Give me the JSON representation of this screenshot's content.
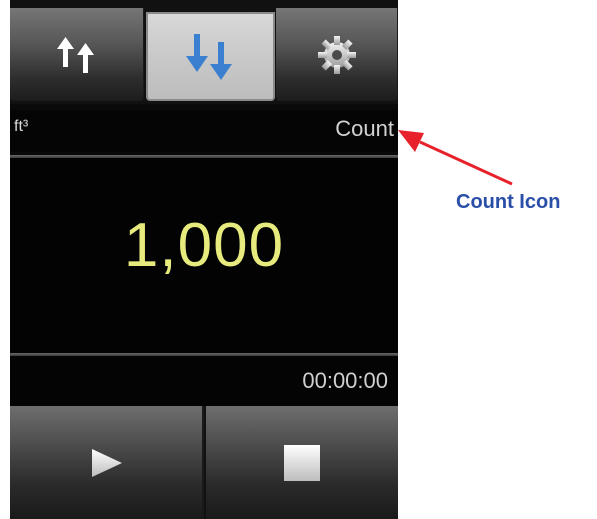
{
  "tabs": [
    {
      "name": "upload",
      "icon": "arrows-up-icon"
    },
    {
      "name": "download",
      "icon": "arrows-down-icon",
      "selected": true
    },
    {
      "name": "settings",
      "icon": "gear-icon"
    }
  ],
  "header": {
    "unit": "ft³",
    "mode": "Count"
  },
  "display": {
    "value": "1,000",
    "timer": "00:00:00"
  },
  "controls": {
    "play_icon": "play-icon",
    "stop_icon": "stop-icon"
  },
  "annotation": {
    "label": "Count Icon"
  },
  "colors": {
    "value_text": "#e7ea7c",
    "accent_blue": "#3a7fd0",
    "arrow_red": "#e8222a",
    "annotation_text": "#2a4fa8"
  }
}
